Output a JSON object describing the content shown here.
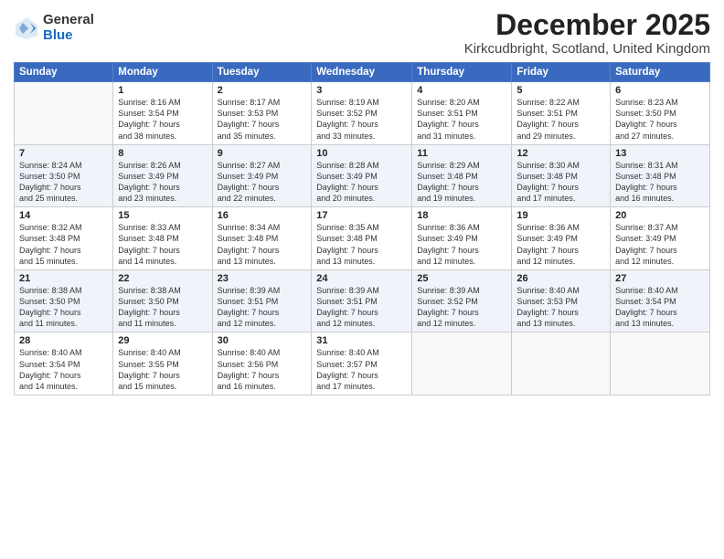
{
  "logo": {
    "general": "General",
    "blue": "Blue"
  },
  "title": "December 2025",
  "location": "Kirkcudbright, Scotland, United Kingdom",
  "weekdays": [
    "Sunday",
    "Monday",
    "Tuesday",
    "Wednesday",
    "Thursday",
    "Friday",
    "Saturday"
  ],
  "weeks": [
    [
      {
        "day": "",
        "info": ""
      },
      {
        "day": "1",
        "info": "Sunrise: 8:16 AM\nSunset: 3:54 PM\nDaylight: 7 hours\nand 38 minutes."
      },
      {
        "day": "2",
        "info": "Sunrise: 8:17 AM\nSunset: 3:53 PM\nDaylight: 7 hours\nand 35 minutes."
      },
      {
        "day": "3",
        "info": "Sunrise: 8:19 AM\nSunset: 3:52 PM\nDaylight: 7 hours\nand 33 minutes."
      },
      {
        "day": "4",
        "info": "Sunrise: 8:20 AM\nSunset: 3:51 PM\nDaylight: 7 hours\nand 31 minutes."
      },
      {
        "day": "5",
        "info": "Sunrise: 8:22 AM\nSunset: 3:51 PM\nDaylight: 7 hours\nand 29 minutes."
      },
      {
        "day": "6",
        "info": "Sunrise: 8:23 AM\nSunset: 3:50 PM\nDaylight: 7 hours\nand 27 minutes."
      }
    ],
    [
      {
        "day": "7",
        "info": "Sunrise: 8:24 AM\nSunset: 3:50 PM\nDaylight: 7 hours\nand 25 minutes."
      },
      {
        "day": "8",
        "info": "Sunrise: 8:26 AM\nSunset: 3:49 PM\nDaylight: 7 hours\nand 23 minutes."
      },
      {
        "day": "9",
        "info": "Sunrise: 8:27 AM\nSunset: 3:49 PM\nDaylight: 7 hours\nand 22 minutes."
      },
      {
        "day": "10",
        "info": "Sunrise: 8:28 AM\nSunset: 3:49 PM\nDaylight: 7 hours\nand 20 minutes."
      },
      {
        "day": "11",
        "info": "Sunrise: 8:29 AM\nSunset: 3:48 PM\nDaylight: 7 hours\nand 19 minutes."
      },
      {
        "day": "12",
        "info": "Sunrise: 8:30 AM\nSunset: 3:48 PM\nDaylight: 7 hours\nand 17 minutes."
      },
      {
        "day": "13",
        "info": "Sunrise: 8:31 AM\nSunset: 3:48 PM\nDaylight: 7 hours\nand 16 minutes."
      }
    ],
    [
      {
        "day": "14",
        "info": "Sunrise: 8:32 AM\nSunset: 3:48 PM\nDaylight: 7 hours\nand 15 minutes."
      },
      {
        "day": "15",
        "info": "Sunrise: 8:33 AM\nSunset: 3:48 PM\nDaylight: 7 hours\nand 14 minutes."
      },
      {
        "day": "16",
        "info": "Sunrise: 8:34 AM\nSunset: 3:48 PM\nDaylight: 7 hours\nand 13 minutes."
      },
      {
        "day": "17",
        "info": "Sunrise: 8:35 AM\nSunset: 3:48 PM\nDaylight: 7 hours\nand 13 minutes."
      },
      {
        "day": "18",
        "info": "Sunrise: 8:36 AM\nSunset: 3:49 PM\nDaylight: 7 hours\nand 12 minutes."
      },
      {
        "day": "19",
        "info": "Sunrise: 8:36 AM\nSunset: 3:49 PM\nDaylight: 7 hours\nand 12 minutes."
      },
      {
        "day": "20",
        "info": "Sunrise: 8:37 AM\nSunset: 3:49 PM\nDaylight: 7 hours\nand 12 minutes."
      }
    ],
    [
      {
        "day": "21",
        "info": "Sunrise: 8:38 AM\nSunset: 3:50 PM\nDaylight: 7 hours\nand 11 minutes."
      },
      {
        "day": "22",
        "info": "Sunrise: 8:38 AM\nSunset: 3:50 PM\nDaylight: 7 hours\nand 11 minutes."
      },
      {
        "day": "23",
        "info": "Sunrise: 8:39 AM\nSunset: 3:51 PM\nDaylight: 7 hours\nand 12 minutes."
      },
      {
        "day": "24",
        "info": "Sunrise: 8:39 AM\nSunset: 3:51 PM\nDaylight: 7 hours\nand 12 minutes."
      },
      {
        "day": "25",
        "info": "Sunrise: 8:39 AM\nSunset: 3:52 PM\nDaylight: 7 hours\nand 12 minutes."
      },
      {
        "day": "26",
        "info": "Sunrise: 8:40 AM\nSunset: 3:53 PM\nDaylight: 7 hours\nand 13 minutes."
      },
      {
        "day": "27",
        "info": "Sunrise: 8:40 AM\nSunset: 3:54 PM\nDaylight: 7 hours\nand 13 minutes."
      }
    ],
    [
      {
        "day": "28",
        "info": "Sunrise: 8:40 AM\nSunset: 3:54 PM\nDaylight: 7 hours\nand 14 minutes."
      },
      {
        "day": "29",
        "info": "Sunrise: 8:40 AM\nSunset: 3:55 PM\nDaylight: 7 hours\nand 15 minutes."
      },
      {
        "day": "30",
        "info": "Sunrise: 8:40 AM\nSunset: 3:56 PM\nDaylight: 7 hours\nand 16 minutes."
      },
      {
        "day": "31",
        "info": "Sunrise: 8:40 AM\nSunset: 3:57 PM\nDaylight: 7 hours\nand 17 minutes."
      },
      {
        "day": "",
        "info": ""
      },
      {
        "day": "",
        "info": ""
      },
      {
        "day": "",
        "info": ""
      }
    ]
  ]
}
